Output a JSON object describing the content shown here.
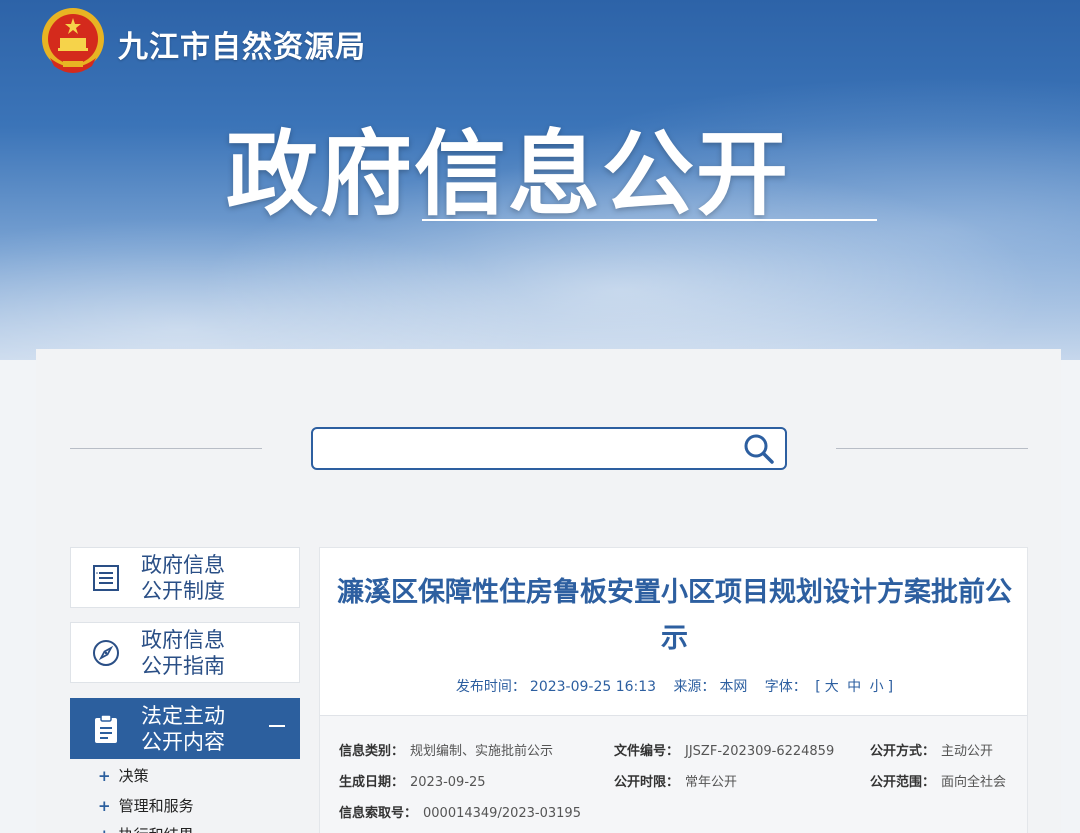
{
  "header": {
    "site_name": "九江市自然资源局",
    "hero_title": "政府信息公开"
  },
  "search": {
    "placeholder": ""
  },
  "sidebar": {
    "items": [
      {
        "label": "政府信息公开制度",
        "line1": "政府信息",
        "line2": "公开制度",
        "icon": "list-document-icon"
      },
      {
        "label": "政府信息公开指南",
        "line1": "政府信息",
        "line2": "公开指南",
        "icon": "compass-icon"
      },
      {
        "label": "法定主动公开内容",
        "line1": "法定主动",
        "line2": "公开内容",
        "icon": "clipboard-icon"
      }
    ],
    "sub_items": [
      "决策",
      "管理和服务",
      "执行和结果"
    ]
  },
  "article": {
    "title": "濂溪区保障性住房鲁板安置小区项目规划设计方案批前公示",
    "publish_label": "发布时间：",
    "publish_time": "2023-09-25 16:13",
    "source_label": "来源：",
    "source": "本网",
    "font_label": "字体：",
    "font_open": "[",
    "font_large": "大",
    "font_medium": "中",
    "font_small": "小",
    "font_close": "]"
  },
  "info": {
    "category_label": "信息类别：",
    "category": "规划编制、实施批前公示",
    "doc_no_label": "文件编号：",
    "doc_no": "JJSZF-202309-6224859",
    "open_mode_label": "公开方式：",
    "open_mode": "主动公开",
    "date_label": "生成日期：",
    "date": "2023-09-25",
    "period_label": "公开时限：",
    "period": "常年公开",
    "scope_label": "公开范围：",
    "scope": "面向全社会",
    "index_label": "信息索取号：",
    "index": "000014349/2023-03195"
  }
}
